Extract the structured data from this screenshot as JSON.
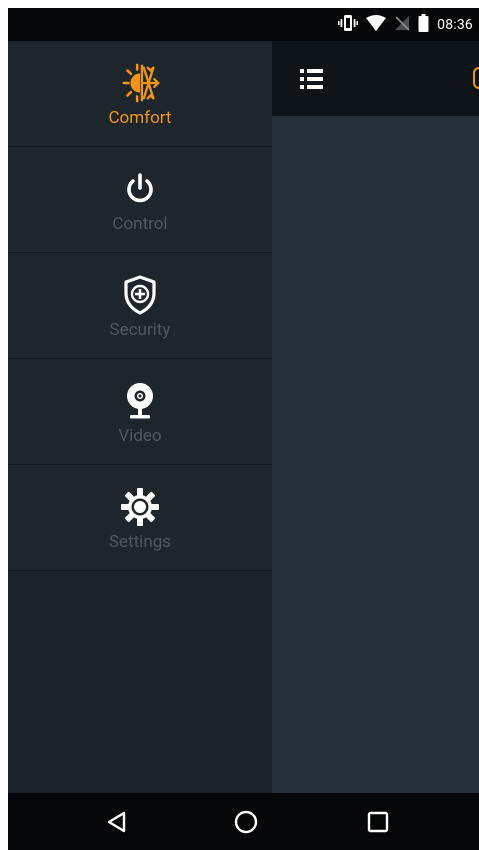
{
  "status_bar": {
    "time": "08:36",
    "icons": [
      "vibrate-icon",
      "wifi-icon",
      "no-signal-icon",
      "battery-icon"
    ]
  },
  "drawer": {
    "items": [
      {
        "label": "Comfort",
        "icon": "comfort-sun-snowflake-icon",
        "active": true
      },
      {
        "label": "Control",
        "icon": "power-icon",
        "active": false
      },
      {
        "label": "Security",
        "icon": "shield-plus-icon",
        "active": false
      },
      {
        "label": "Video",
        "icon": "webcam-icon",
        "active": false
      },
      {
        "label": "Settings",
        "icon": "gear-icon",
        "active": false
      }
    ]
  },
  "appbar": {
    "menu_icon": "list-menu-icon"
  },
  "nav_bar": {
    "buttons": [
      "back-icon",
      "home-icon",
      "recents-icon"
    ]
  },
  "colors": {
    "accent": "#f29415",
    "drawer_bg": "#1e262c",
    "content_bg": "#25303a",
    "inactive_label": "#4f5861"
  }
}
